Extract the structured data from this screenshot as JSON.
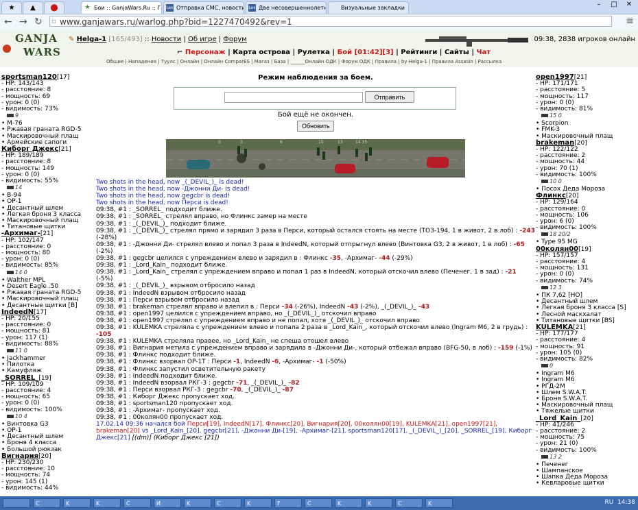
{
  "browser": {
    "pinned_tabs": [
      "★",
      "▲",
      "⬤"
    ],
    "tabs": [
      {
        "label": "Бои :: GanjaWars.Ru :: Ган",
        "icon": "★"
      },
      {
        "label": "Отправка СМС, новости со",
        "icon": "Lex"
      },
      {
        "label": "Две несовершеннолетние",
        "icon": "Lex"
      },
      {
        "label": "Визуальные закладки",
        "icon": ""
      }
    ],
    "url": "www.ganjawars.ru/warlog.php?bid=1227470492&rev=1"
  },
  "header": {
    "logo_top": "GANJA",
    "logo_bottom": "WARS",
    "user": "Helga-1",
    "hp": "[165/493]",
    "sep1": " :: ",
    "links": [
      "Новости",
      "Об игре",
      "Форум"
    ],
    "right_info": "09:38, 2838 игроков онлайн",
    "mainnav": [
      {
        "label": "Персонаж",
        "red": true
      },
      {
        "label": "Карта острова",
        "red": false
      },
      {
        "label": "Рулетка",
        "red": false
      },
      {
        "label": "Бой [01:42][3]",
        "red": true
      },
      {
        "label": "Рейтинги",
        "red": false
      },
      {
        "label": "Сайты",
        "red": false
      },
      {
        "label": "Чат",
        "red": true
      }
    ],
    "subnav": "Общие | Нападения | Туулс | Онлайн | Онлайн ComparES | Магаз | База | ______Онлайн ОДК | Форум ОДК | Правила | by Helga-1 | Правила Assasin | Рассылка"
  },
  "left_players": [
    {
      "name": "sportsman120",
      "level": "[17]",
      "stats": [
        "- HP: 143/143",
        "- расстояние: 8",
        "- мощность: 69",
        "- урон: 0 (0)",
        "- видимость: 73%"
      ],
      "weapon_text": "9",
      "items": [
        "M-76",
        "Ржавая граната RGD-5",
        "Маскировочный плащ",
        "Армейские сапоги"
      ]
    },
    {
      "name": "Киборг Джекс",
      "level": "[21]",
      "stats": [
        "- HP: 189/189",
        "- расстояние: 8",
        "- мощность: 149",
        "- урон: 0 (0)",
        "- видимость: 55%"
      ],
      "weapon_text": "14",
      "items": [
        "B-94",
        "OP-1",
        "Десантный шлем",
        "Легкая броня 3 класса",
        "Маскировочный плащ",
        "Титановые щитки"
      ]
    },
    {
      "name": "-Архимаг-",
      "level": "[21]",
      "stats": [
        "- HP: 102/147",
        "- расстояние: 0",
        "- мощность: 80",
        "- урон: 0 (0)",
        "- видимость: 85%"
      ],
      "weapon_text": "14 0",
      "items": [
        "Walther MPL",
        "Desert Eagle .50",
        "Ржавая граната RGD-5",
        "Маскировочный плащ",
        "Десантные щитки [B]"
      ]
    },
    {
      "name": "IndeedN",
      "level": "[17]",
      "stats": [
        "- HP: 20/155",
        "- расстояние: 0",
        "- мощность: 81",
        "- урон: 117 (1)",
        "- видимость: 88%"
      ],
      "weapon_text": "11 0",
      "items": [
        "Jackhammer",
        "Пилотка",
        "Камуфляж"
      ]
    },
    {
      "name": "_SORREL_",
      "level": "[19]",
      "stats": [
        "- HP: 109/109",
        "- расстояние: 4",
        "- мощность: 65",
        "- урон: 0 (0)",
        "- видимость: 100%"
      ],
      "weapon_text": "10 4",
      "items": [
        "Винтовка G3",
        "OP-1",
        "Десантный шлем",
        "Броня 4 класса",
        "Большой рюкзак"
      ]
    },
    {
      "name": "Вигнария",
      "level": "[20]",
      "stats": [
        "- HP: 230/230",
        "- расстояние: 10",
        "- мощность: 74",
        "- урон: 145 (1)",
        "- видимость: 44%"
      ],
      "weapon_text": "",
      "items": []
    }
  ],
  "right_players": [
    {
      "name": "open1997",
      "level": "[21]",
      "stats": [
        "- HP: 171/171",
        "- расстояние: 5",
        "- мощность: 117",
        "- урон: 0 (0)",
        "- видимость: 81%"
      ],
      "weapon_text": "15 0",
      "items": [
        "Scorpion",
        "FMK-3",
        "Маскировочный плащ"
      ]
    },
    {
      "name": "brakeman",
      "level": "[20]",
      "stats": [
        "- HP: 122/122",
        "- расстояние: 2",
        "- мощность: 44",
        "- урон: 70 (1)",
        "- видимость: 100%"
      ],
      "weapon_text": "10 0",
      "items": [
        "Посох Деда Мороза"
      ]
    },
    {
      "name": "Флинкс",
      "level": "[20]",
      "stats": [
        "- HP: 129/164",
        "- расстояние: 0",
        "- мощность: 106",
        "- урон: 6 (0)",
        "- видимость: 100%"
      ],
      "weapon_text": "18 20/2",
      "items": [
        "Type 95 MG"
      ]
    },
    {
      "name": "00колян00",
      "level": "[19]",
      "stats": [
        "- HP: 157/157",
        "- расстояние: 4",
        "- мощность: 131",
        "- урон: 0 (0)",
        "- видимость: 74%"
      ],
      "weapon_text": "12 3",
      "items": [
        "ПК 7,62 [HO]",
        "Десантный шлем",
        "Легкая броня 3 класса [S]",
        "Лесной маскхалат",
        "Титановые щитки [BS]"
      ]
    },
    {
      "name": "KULEMKA",
      "level": "[21]",
      "stats": [
        "- HP: 177/177",
        "- расстояние: 4",
        "- мощность: 91",
        "- урон: 105 (0)",
        "- видимость: 82%"
      ],
      "weapon_text": "0",
      "items": [
        "Ingram M6",
        "Ingram M6",
        "РГД-2М",
        "Шлем S.W.A.T.",
        "Броня S.W.A.T.",
        "Маскировочный плащ",
        "Тяжелые щитки"
      ]
    },
    {
      "name": "_Lord_Kain_",
      "level": "[20]",
      "stats": [
        "- HP: 41/246",
        "- расстояние: 2",
        "- мощность: 75",
        "- урон: 21 (0)",
        "- видимость: 100%"
      ],
      "weapon_text": "13 2",
      "items": [
        "Печенег",
        "Шампанское",
        "Шапка Деда Мороза",
        "Кевларовые щитки"
      ]
    }
  ],
  "center": {
    "mode_title": "Режим наблюдения за боем.",
    "send_button": "Отправить",
    "message_value": "",
    "status": "Бой ещё не окончен.",
    "refresh_button": "Обновить",
    "map_labels": [
      "0",
      "3",
      "6",
      "10",
      "13",
      "14 15"
    ],
    "headshots": [
      "Two shots in the head, now _(_DEVIL_)_ is dead!",
      "Two shots in the head, now -Джонни Ди- is dead!",
      "Two shots in the head, now gegcbr is dead!",
      "Two shots in the head, now Перси is dead!"
    ],
    "log": [
      "09:38, #1 : _SORREL_ подходит ближе.",
      "09:38, #1 : _SORREL_ стрелял вправо, но Флинкс замер на месте",
      "09:38, #1 : _(_DEVIL_)_ подходит ближе.",
      "09:38, #1 : _(_DEVIL_)_ стрелял прямо и зарядил 3 раза в Перси, который остался стоять на месте (ТОЗ-194, 1 в живот, 2 в лоб) : -243 (-28%)",
      "09:38, #1 : -Джонни Ди- стрелял влево и попал 3 раза в IndeedN, который отпрыгнул влево (Винтовка G3, 2 в живот, 1 в лоб) : -65 (-2%)",
      "09:38, #1 : gegcbr целился с упреждением влево и зарядил в : Флинкс -35, -Архимаг- -44 (-29%)",
      "09:38, #1 : _Lord_Kain_ подходит ближе.",
      "09:38, #1 : _Lord_Kain_ стрелял с упреждением вправо и попал 1 раз в IndeedN, который отскочил влево (Печенег, 1 в зад) : -21 (-5%)",
      "09:38, #1 : _(_DEVIL_)_ взрывом отбросило назад",
      "09:38, #1 : IndeedN взрывом отбросило назад",
      "09:38, #1 : Перси взрывом отбросило назад",
      "09:38, #1 : brakeman стрелял вправо и влепил в : Перси -34 (-26%), IndeedN -43 (-2%), _(_DEVIL_)_ -43",
      "09:38, #1 : open1997 целился с упреждением вправо, но _(_DEVIL_)_ отскочил вправо",
      "09:38, #1 : open1997 стрелял с упреждением вправо и не попал, хотя _(_DEVIL_)_ отскочил вправо",
      "09:38, #1 : KULEMKA стреляла с упреждением влево и попала 2 раза в _Lord_Kain_, который отскочил влево (Ingram M6, 2 в грудь) : -105",
      "09:38, #1 : KULEMKA стреляла правее, но _Lord_Kain_ не спеша отошел влево",
      "09:38, #1 : Вигнария метила с упреждением вправо и зарядила в -Джонни Ди-, который отбежал вправо (BFG-50, в лоб) : -159 (-1%)",
      "09:38, #1 : Флинкс подходит ближе.",
      "09:38, #1 : Флинкс взорвал OP-1T : Перси -1, IndeedN -6, -Архимаг- -1 (-50%)",
      "09:38, #1 : Флинкс запустил осветительную ракету",
      "09:38, #1 : IndeedN подходит ближе.",
      "09:38, #1 : IndeedN взорвал РКГ-3 : gegcbr -71, _(_DEVIL_)_ -82",
      "09:38, #1 : Перси взорвал РКГ-3 : gegcbr -70, _(_DEVIL_)_ -87",
      "09:38, #1 : Киборг Джекс пропускает ход.",
      "09:38, #1 : sportsman120 пропускает ход.",
      "09:38, #1 : -Архимаг- пропускает ход.",
      "09:38, #1 : 00колян00 пропускает ход."
    ],
    "footer_start": "17.02.14 09:36 начался бой ",
    "footer_red": "Перси[19], IndeedN[17], Флинкс[20], Вигнария[20], 00колян00[19], KULEMKA[21], open1997[21], brakeman[20]",
    "footer_vs": " vs ",
    "footer_blue": "_Lord_Kain_[20], gegcbr[21], -Джонни Ди-[19], -Архимаг-[21], sportsman120[17], _(_DEVIL_)_[20], _SORREL_[19], Киборг Джекс[21]",
    "footer_end": " [(dm)] (Киборг Джекс [21])"
  },
  "taskbar": {
    "items": [
      "",
      "C",
      "K",
      "K",
      "C",
      "И",
      "K",
      "C",
      "K",
      "F",
      "C",
      "K",
      "K",
      "C",
      "K"
    ],
    "lang": "RU",
    "clock": "14:38"
  },
  "colors": {
    "log_blue": "#1a2ab0",
    "damage_red": "#b01818",
    "header_bg": "#f0f4ed"
  }
}
